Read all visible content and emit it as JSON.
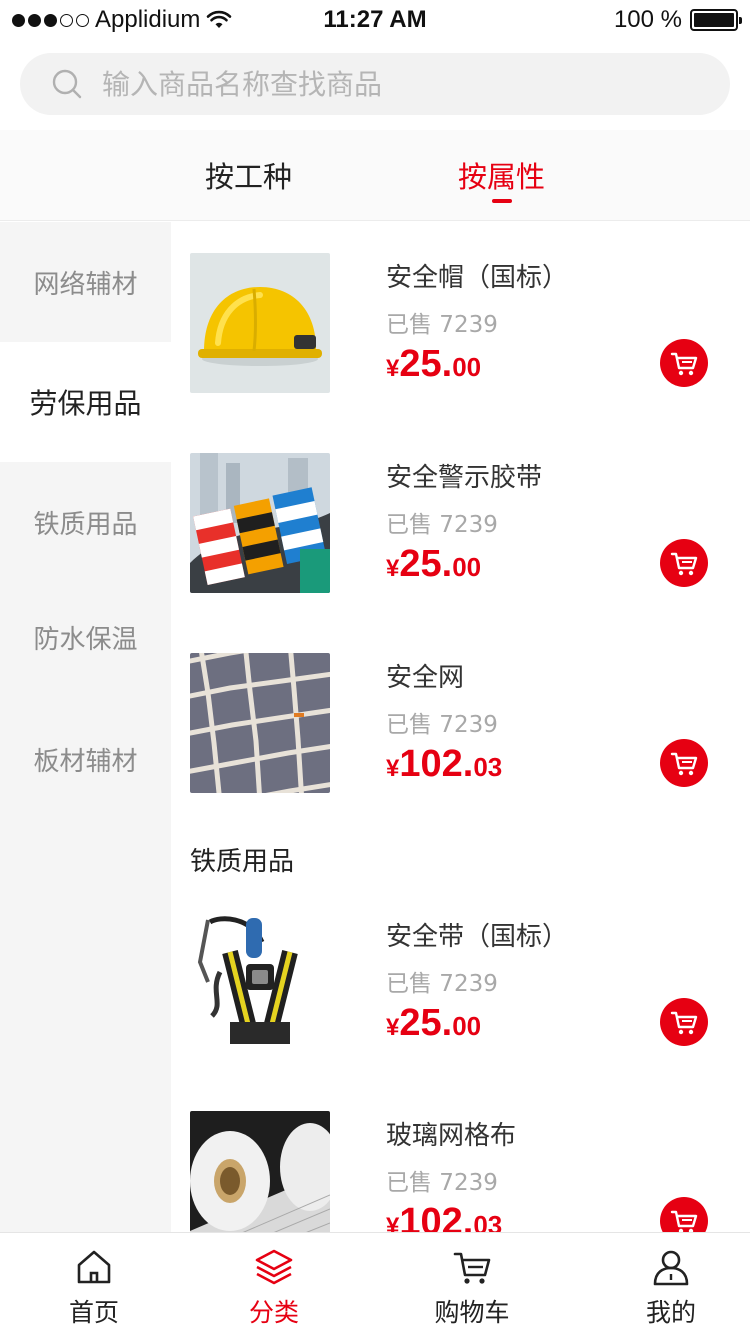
{
  "status_bar": {
    "carrier": "Applidium",
    "time": "11:27 AM",
    "battery": "100 %"
  },
  "search": {
    "placeholder": "输入商品名称查找商品"
  },
  "tabs": [
    {
      "label": "按工种",
      "active": false
    },
    {
      "label": "按属性",
      "active": true
    }
  ],
  "sidebar": {
    "items": [
      {
        "label": "网络辅材",
        "active": false
      },
      {
        "label": "劳保用品",
        "active": true
      },
      {
        "label": "铁质用品",
        "active": false
      },
      {
        "label": "防水保温",
        "active": false
      },
      {
        "label": "板材辅材",
        "active": false
      }
    ]
  },
  "products": [
    {
      "name": "安全帽（国标）",
      "sold": "已售 7239",
      "currency": "¥",
      "price_int": "25.",
      "price_dec": "00"
    },
    {
      "name": "安全警示胶带",
      "sold": "已售 7239",
      "currency": "¥",
      "price_int": "25.",
      "price_dec": "00"
    },
    {
      "name": "安全网",
      "sold": "已售 7239",
      "currency": "¥",
      "price_int": "102.",
      "price_dec": "03"
    },
    {
      "name": "安全带（国标）",
      "sold": "已售 7239",
      "currency": "¥",
      "price_int": "25.",
      "price_dec": "00"
    },
    {
      "name": "玻璃网格布",
      "sold": "已售 7239",
      "currency": "¥",
      "price_int": "102.",
      "price_dec": "03"
    }
  ],
  "section_title": "铁质用品",
  "bottom_nav": [
    {
      "label": "首页",
      "icon": "home-icon",
      "active": false
    },
    {
      "label": "分类",
      "icon": "layers-icon",
      "active": true
    },
    {
      "label": "购物车",
      "icon": "cart-icon",
      "active": false
    },
    {
      "label": "我的",
      "icon": "user-icon",
      "active": false
    }
  ],
  "colors": {
    "accent": "#e60012",
    "sidebar_bg": "#f5f5f5",
    "muted_text": "#a8a8a8"
  }
}
